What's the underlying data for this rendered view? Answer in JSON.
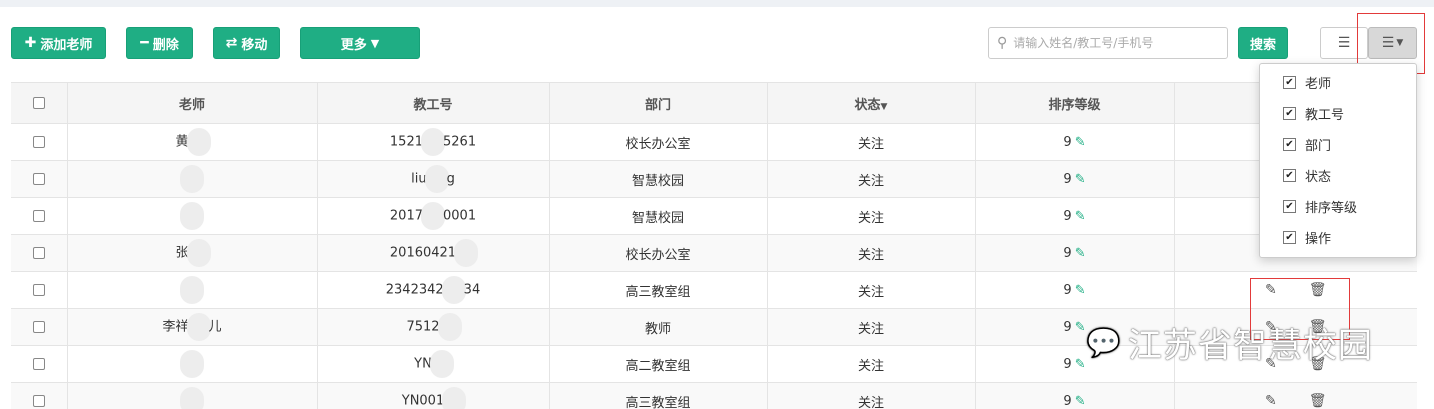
{
  "toolbar": {
    "add_label": "添加老师",
    "delete_label": "删除",
    "move_label": "移动",
    "more_label": "更多",
    "search_placeholder": "请输入姓名/教工号/手机号",
    "search_button": "搜索"
  },
  "table": {
    "columns": [
      "老师",
      "教工号",
      "部门",
      "状态",
      "排序等级"
    ],
    "rows": [
      {
        "teacher_a": "黄",
        "teacher_b": "",
        "id_a": "1521",
        "id_b": "5261",
        "dept": "校长办公室",
        "status": "关注",
        "rank": "9",
        "actions": false
      },
      {
        "teacher_a": "",
        "teacher_b": "",
        "id_a": "liu",
        "id_b": "g",
        "dept": "智慧校园",
        "status": "关注",
        "rank": "9",
        "actions": false
      },
      {
        "teacher_a": "",
        "teacher_b": "",
        "id_a": "2017",
        "id_b": "0001",
        "dept": "智慧校园",
        "status": "关注",
        "rank": "9",
        "actions": false
      },
      {
        "teacher_a": "张",
        "teacher_b": "",
        "id_a": "20160421",
        "id_b": "",
        "dept": "校长办公室",
        "status": "关注",
        "rank": "9",
        "actions": false
      },
      {
        "teacher_a": "",
        "teacher_b": "",
        "id_a": "2342342",
        "id_b": "34",
        "dept": "高三教室组",
        "status": "关注",
        "rank": "9",
        "actions": true
      },
      {
        "teacher_a": "李祥",
        "teacher_b": "儿",
        "id_a": "7512",
        "id_b": "",
        "dept": "教师",
        "status": "关注",
        "rank": "9",
        "actions": true
      },
      {
        "teacher_a": "",
        "teacher_b": "",
        "id_a": "YN",
        "id_b": "",
        "dept": "高二教室组",
        "status": "关注",
        "rank": "9",
        "actions": true
      },
      {
        "teacher_a": "",
        "teacher_b": "",
        "id_a": "YN001",
        "id_b": "",
        "dept": "高三教室组",
        "status": "关注",
        "rank": "9",
        "actions": true
      }
    ]
  },
  "column_menu": {
    "items": [
      "老师",
      "教工号",
      "部门",
      "状态",
      "排序等级",
      "操作"
    ]
  },
  "watermark": "江苏省智慧校园",
  "colors": {
    "accent": "#1fae84",
    "highlight": "#e23a3a"
  }
}
